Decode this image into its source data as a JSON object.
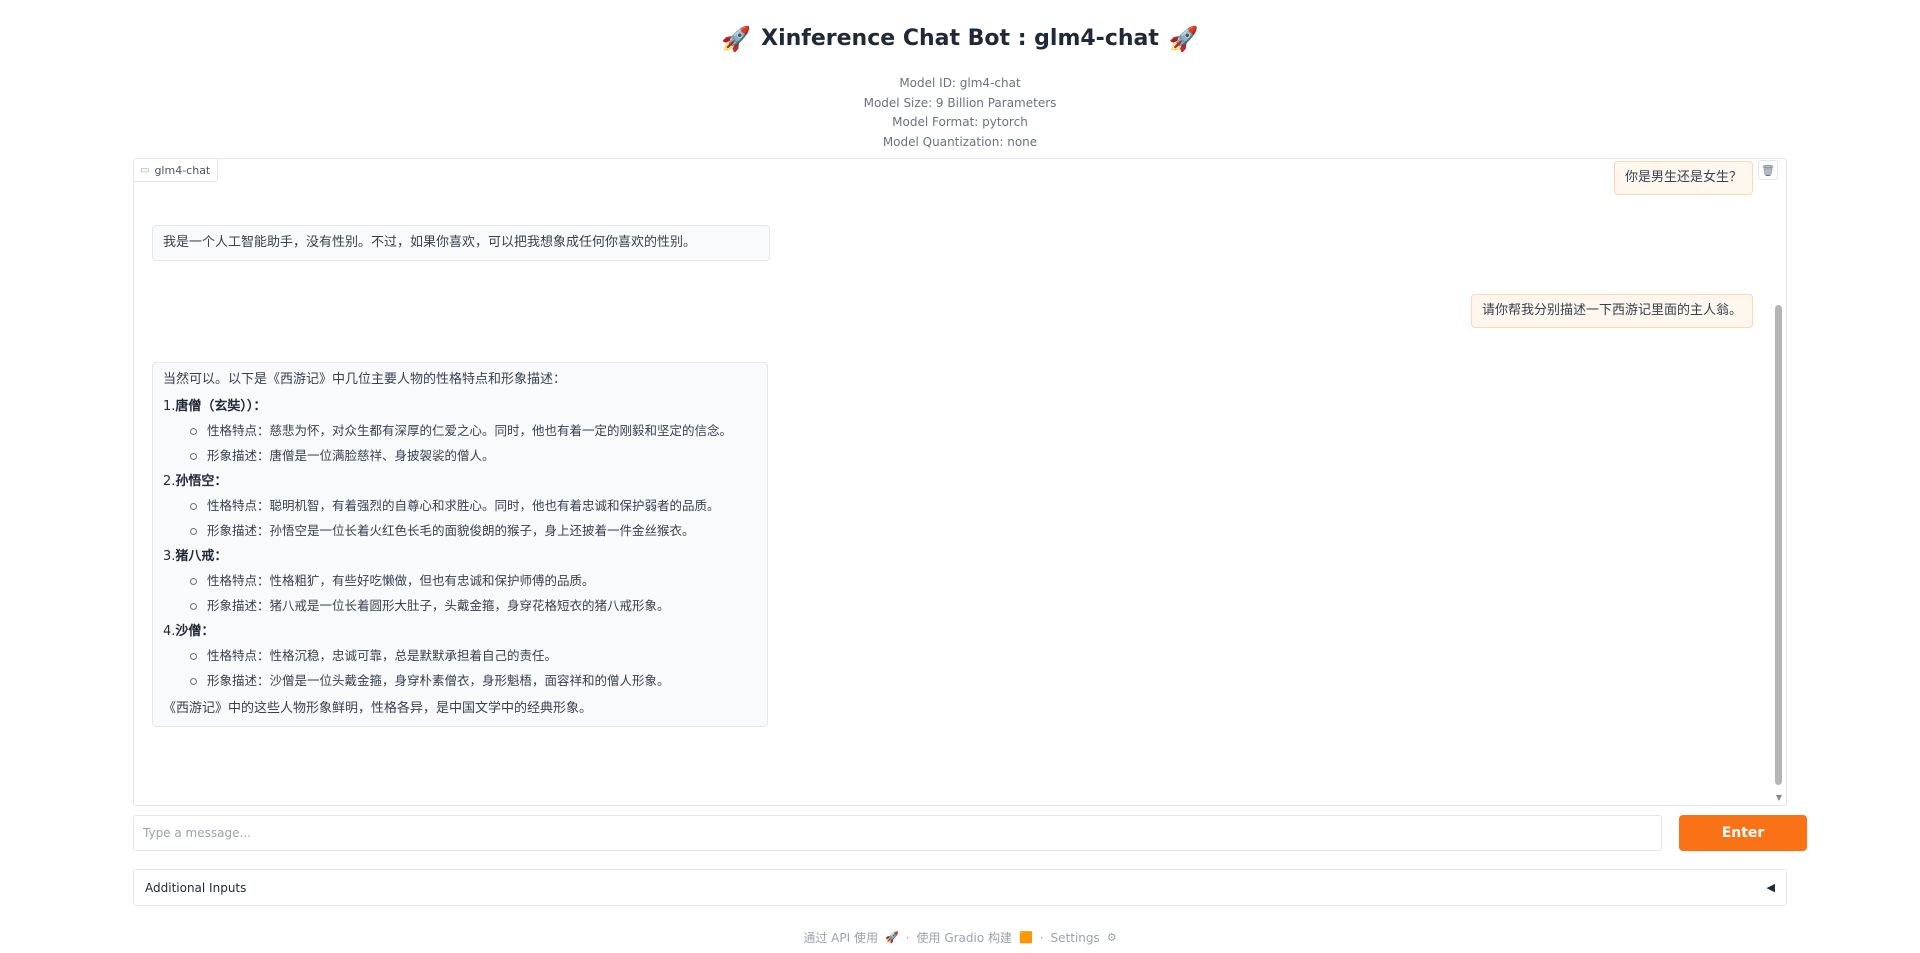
{
  "header": {
    "title": "Xinference Chat Bot : glm4-chat",
    "left_icon": "rocket-icon",
    "right_icon": "rocket-icon",
    "model_id": "Model ID: glm4-chat",
    "model_size": "Model Size: 9 Billion Parameters",
    "model_format": "Model Format: pytorch",
    "model_quantization": "Model Quantization: none"
  },
  "chat": {
    "label": "glm4-chat",
    "messages": [
      {
        "role": "user",
        "text": "你是男生还是女生？"
      },
      {
        "role": "bot",
        "text": "我是一个人工智能助手，没有性别。不过，如果你喜欢，可以把我想象成任何你喜欢的性别。"
      },
      {
        "role": "user",
        "text": "请你帮我分别描述一下西游记里面的主人翁。"
      },
      {
        "role": "bot",
        "intro": "当然可以。以下是《西游记》中几位主要人物的性格特点和形象描述：",
        "items": [
          {
            "num": "1.",
            "name": "唐僧（玄奘））：",
            "traits": "性格特点：慈悲为怀，对众生都有深厚的仁爱之心。同时，他也有着一定的刚毅和坚定的信念。",
            "looks": "形象描述：唐僧是一位满脸慈祥、身披袈裟的僧人。"
          },
          {
            "num": "2.",
            "name": "孙悟空：",
            "traits": "性格特点：聪明机智，有着强烈的自尊心和求胜心。同时，他也有着忠诚和保护弱者的品质。",
            "looks": "形象描述：孙悟空是一位长着火红色长毛的面貌俊朗的猴子，身上还披着一件金丝猴衣。"
          },
          {
            "num": "3.",
            "name": "猪八戒：",
            "traits": "性格特点：性格粗犷，有些好吃懒做，但也有忠诚和保护师傅的品质。",
            "looks": "形象描述：猪八戒是一位长着圆形大肚子，头戴金箍，身穿花格短衣的猪八戒形象。"
          },
          {
            "num": "4.",
            "name": "沙僧：",
            "traits": "性格特点：性格沉稳，忠诚可靠，总是默默承担着自己的责任。",
            "looks": "形象描述：沙僧是一位头戴金箍，身穿朴素僧衣，身形魁梧，面容祥和的僧人形象。"
          }
        ],
        "outro": "《西游记》中的这些人物形象鲜明，性格各异，是中国文学中的经典形象。"
      }
    ]
  },
  "input": {
    "placeholder": "Type a message...",
    "value": ""
  },
  "enter_label": "Enter",
  "accordion": {
    "label": "Additional Inputs",
    "arrow": "◀"
  },
  "footer": {
    "api": "通过 API 使用",
    "gradio": "使用 Gradio 构建",
    "settings": "Settings",
    "separator": "·"
  },
  "colors": {
    "accent": "#f97316",
    "user_bubble_bg": "#fff7ed",
    "user_bubble_border": "#fed7aa",
    "bot_bubble_bg": "#f9fafb"
  }
}
